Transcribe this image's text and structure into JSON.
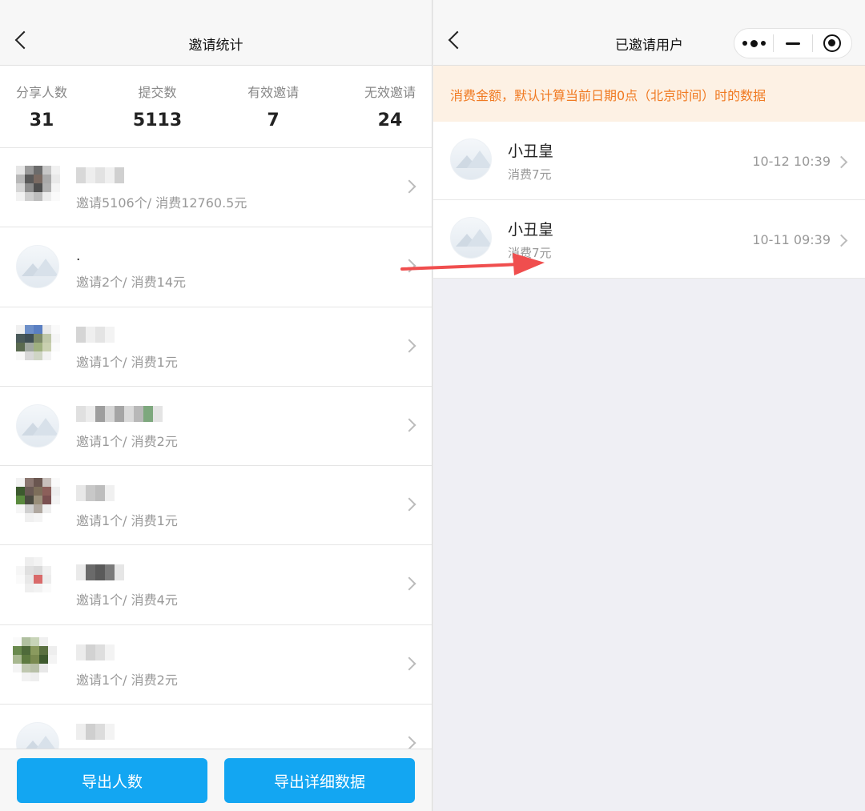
{
  "left": {
    "title": "邀请统计",
    "stats": [
      {
        "label": "分享人数",
        "value": "31"
      },
      {
        "label": "提交数",
        "value": "5113"
      },
      {
        "label": "有效邀请",
        "value": "7"
      },
      {
        "label": "无效邀请",
        "value": "24"
      }
    ],
    "rows": [
      {
        "name": "",
        "sub": "邀请5106个/ 消费12760.5元"
      },
      {
        "name": ".",
        "sub": "邀请2个/ 消费14元"
      },
      {
        "name": "",
        "sub": "邀请1个/ 消费1元"
      },
      {
        "name": "",
        "sub": "邀请1个/ 消费2元"
      },
      {
        "name": "",
        "sub": "邀请1个/ 消费1元"
      },
      {
        "name": "",
        "sub": "邀请1个/ 消费4元"
      },
      {
        "name": "",
        "sub": "邀请1个/ 消费2元"
      },
      {
        "name": "",
        "sub": ""
      }
    ],
    "buttons": {
      "export_count": "导出人数",
      "export_detail": "导出详细数据"
    }
  },
  "right": {
    "title": "已邀请用户",
    "notice": "消费金额，默认计算当前日期0点（北京时间）时的数据",
    "users": [
      {
        "name": "小丑皇",
        "sub": "消费7元",
        "time": "10-12 10:39"
      },
      {
        "name": "小丑皇",
        "sub": "消费7元",
        "time": "10-11 09:39"
      }
    ]
  },
  "colors": {
    "accent": "#13a6f2",
    "notice_text": "#f07a22",
    "notice_bg": "#fdf1e4",
    "arrow": "#f04e4e"
  }
}
